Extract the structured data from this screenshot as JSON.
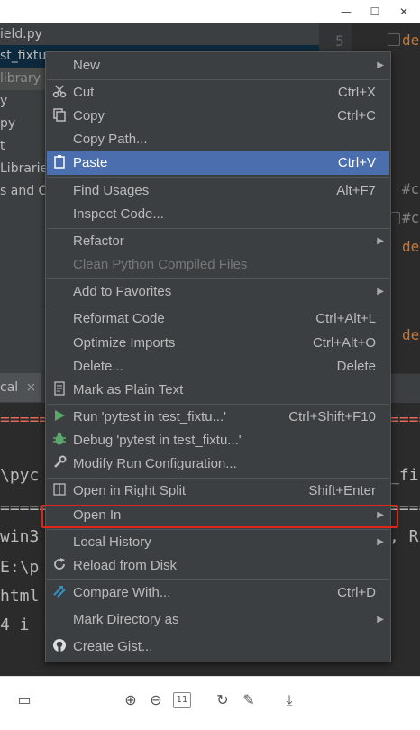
{
  "project_tree": [
    {
      "text": "ield.py"
    },
    {
      "text": "st_fixtu"
    },
    {
      "text": "library"
    },
    {
      "text": "y"
    },
    {
      "text": "py"
    },
    {
      "text": "t"
    },
    {
      "text": "Librarie"
    },
    {
      "text": "s and C"
    }
  ],
  "editor": {
    "line_5": "5",
    "kw_def_1": "de",
    "comment_1": "#c",
    "comment_2": "#c",
    "kw_def_2": "de",
    "kw_def_3": "de"
  },
  "run_panel": {
    "tab_label": "cal",
    "close": "×"
  },
  "console": [
    {
      "text": "======"
    },
    {
      "text": "\\pyc"
    },
    {
      "text": "======"
    },
    {
      "text": "win3"
    },
    {
      "text": "E:\\p"
    },
    {
      "text": "html"
    },
    {
      "text": " 4 i"
    }
  ],
  "console_right": [
    {
      "text": "===="
    },
    {
      "text": "_fi"
    },
    {
      "text": "===="
    },
    {
      "text": ", R"
    }
  ],
  "menu": {
    "items": [
      {
        "label": "New",
        "shortcut": "",
        "submenu": true
      },
      {
        "label": "Cut",
        "shortcut": "Ctrl+X"
      },
      {
        "label": "Copy",
        "shortcut": "Ctrl+C"
      },
      {
        "label": "Copy Path...",
        "shortcut": ""
      },
      {
        "label": "Paste",
        "shortcut": "Ctrl+V"
      },
      {
        "label": "Find Usages",
        "shortcut": "Alt+F7"
      },
      {
        "label": "Inspect Code...",
        "shortcut": ""
      },
      {
        "label": "Refactor",
        "shortcut": "",
        "submenu": true
      },
      {
        "label": "Clean Python Compiled Files",
        "shortcut": ""
      },
      {
        "label": "Add to Favorites",
        "shortcut": "",
        "submenu": true
      },
      {
        "label": "Reformat Code",
        "shortcut": "Ctrl+Alt+L"
      },
      {
        "label": "Optimize Imports",
        "shortcut": "Ctrl+Alt+O"
      },
      {
        "label": "Delete...",
        "shortcut": "Delete"
      },
      {
        "label": "Mark as Plain Text",
        "shortcut": ""
      },
      {
        "label": "Run 'pytest in test_fixtu...'",
        "shortcut": "Ctrl+Shift+F10"
      },
      {
        "label": "Debug 'pytest in test_fixtu...'",
        "shortcut": ""
      },
      {
        "label": "Modify Run Configuration...",
        "shortcut": ""
      },
      {
        "label": "Open in Right Split",
        "shortcut": "Shift+Enter"
      },
      {
        "label": "Open In",
        "shortcut": "",
        "submenu": true
      },
      {
        "label": "Local History",
        "shortcut": "",
        "submenu": true
      },
      {
        "label": "Reload from Disk",
        "shortcut": ""
      },
      {
        "label": "Compare With...",
        "shortcut": "Ctrl+D"
      },
      {
        "label": "Mark Directory as",
        "shortcut": "",
        "submenu": true
      },
      {
        "label": "Create Gist...",
        "shortcut": ""
      }
    ],
    "selected_item": "Paste",
    "highlighted_item": "Open In",
    "arrow_glyph": "▶"
  },
  "bottom_toolbar": {
    "page_box": "11"
  },
  "colors": {
    "menu_bg": "#3c3f41",
    "selection": "#4b6eaf",
    "highlight_box": "#e1251b",
    "keyword": "#cc7832",
    "comment": "#808080"
  }
}
